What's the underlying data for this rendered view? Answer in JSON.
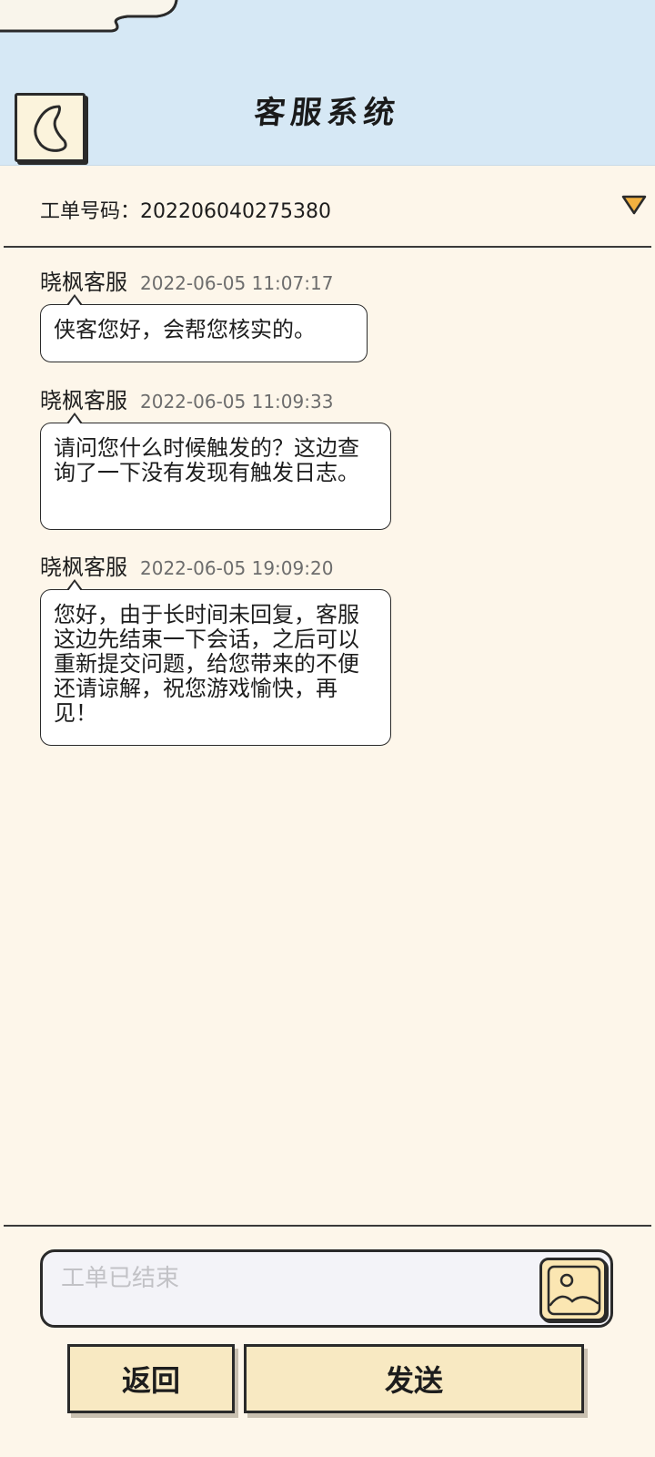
{
  "header": {
    "title": "客服系统",
    "back_icon": "back-icon"
  },
  "ticket": {
    "label": "工单号码：",
    "number": "202206040275380",
    "toggle_icon": "caret-down-icon",
    "toggle_color": "#f2b140"
  },
  "messages": [
    {
      "sender": "晓枫客服",
      "time": "2022-06-05 11:07:17",
      "text": "侠客您好，会帮您核实的。"
    },
    {
      "sender": "晓枫客服",
      "time": "2022-06-05 11:09:33",
      "text": "请问您什么时候触发的？这边查询了一下没有发现有触发日志。"
    },
    {
      "sender": "晓枫客服",
      "time": "2022-06-05 19:09:20",
      "text": "您好，由于长时间未回复，客服这边先结束一下会话，之后可以重新提交问题，给您带来的不便还请谅解，祝您游戏愉快，再见！"
    }
  ],
  "composer": {
    "placeholder": "工单已结束",
    "value": "",
    "image_icon": "image-icon"
  },
  "buttons": {
    "back_label": "返回",
    "send_label": "发送"
  },
  "colors": {
    "header_bg": "#d6e8f5",
    "page_bg": "#fdf6ea",
    "button_bg": "#f8e9c2"
  }
}
